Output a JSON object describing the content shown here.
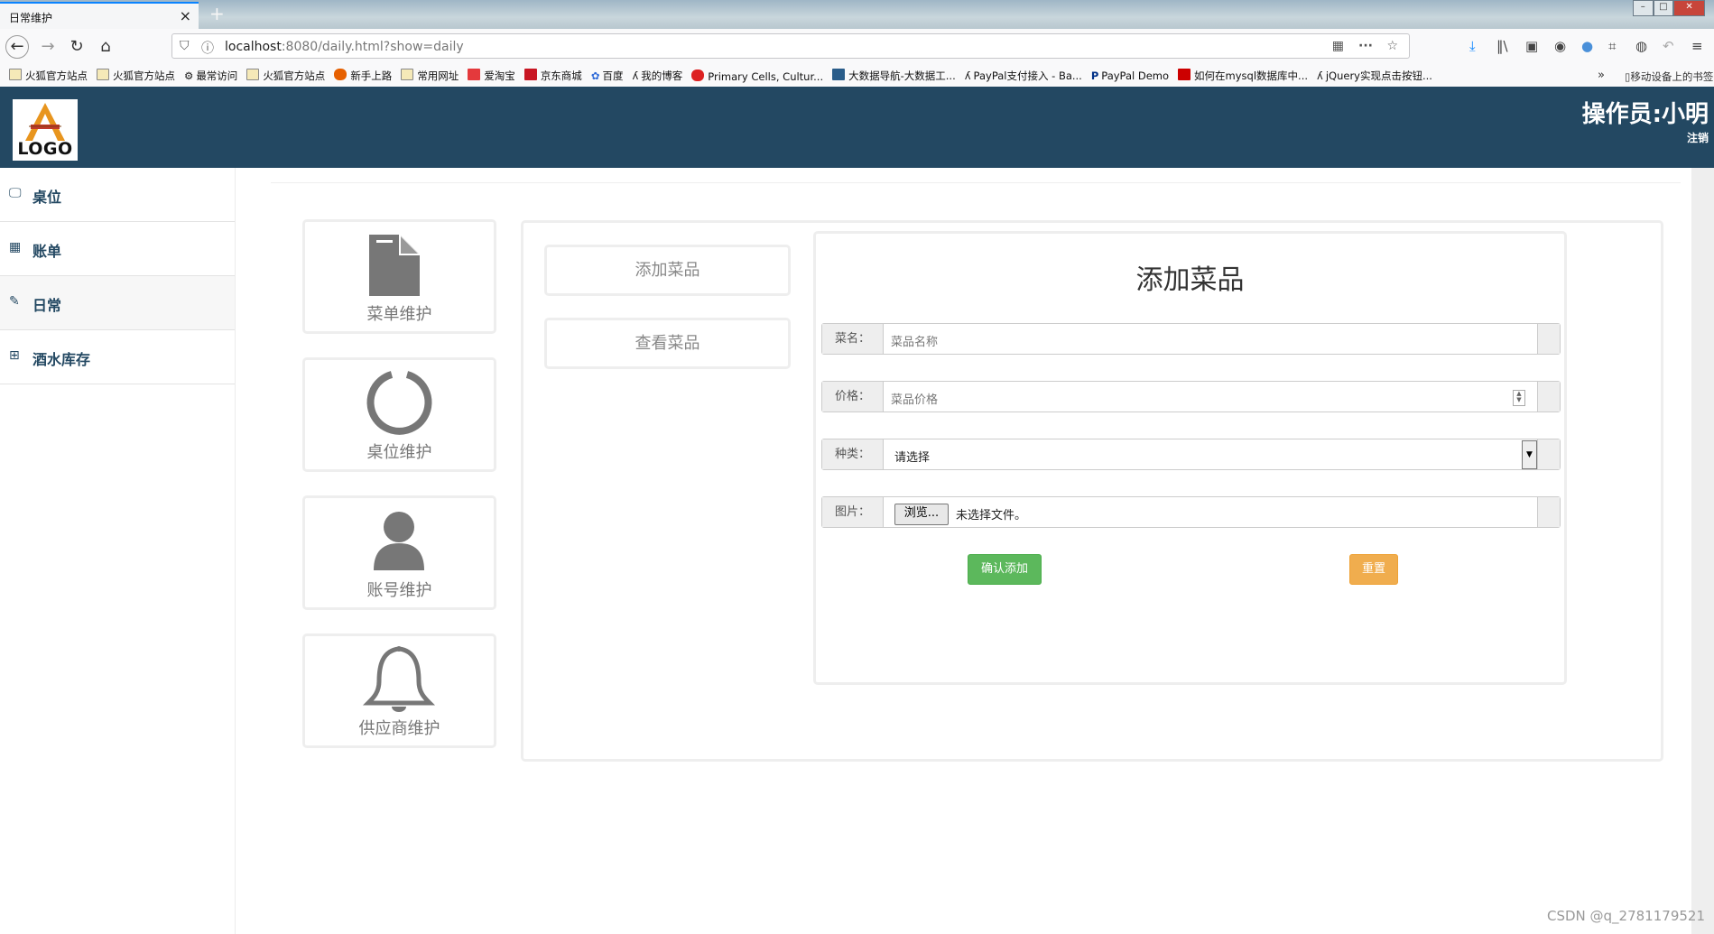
{
  "browser": {
    "tab_title": "日常维护",
    "tab_close": "×",
    "new_tab": "+",
    "url_host": "localhost",
    "url_rest": ":8080/daily.html?show=daily",
    "bookmarks": [
      "火狐官方站点",
      "火狐官方站点",
      "最常访问",
      "火狐官方站点",
      "新手上路",
      "常用网址",
      "爱淘宝",
      "京东商城",
      "百度",
      "我的博客",
      "Primary Cells, Cultur...",
      "大数据导航-大数据工...",
      "PayPal支付接入 - Ba...",
      "PayPal Demo",
      "如何在mysql数据库中...",
      "jQuery实现点击按钮..."
    ],
    "bookmarks_more": "»",
    "bookmarks_mobile": "移动设备上的书签"
  },
  "header": {
    "logo_text": "LOGO",
    "operator": "操作员:小明",
    "logout": "注销"
  },
  "sidebar": {
    "items": [
      {
        "label": "桌位",
        "icon": "monitor-icon"
      },
      {
        "label": "账单",
        "icon": "table-icon"
      },
      {
        "label": "日常",
        "icon": "edit-icon"
      },
      {
        "label": "酒水库存",
        "icon": "grid-icon"
      }
    ],
    "active": "日常"
  },
  "tiles": [
    {
      "label": "菜单维护",
      "icon": "file-icon"
    },
    {
      "label": "桌位维护",
      "icon": "power-ring-icon"
    },
    {
      "label": "账号维护",
      "icon": "user-icon"
    },
    {
      "label": "供应商维护",
      "icon": "bell-icon"
    }
  ],
  "subnav": {
    "add": "添加菜品",
    "view": "查看菜品"
  },
  "form": {
    "title": "添加菜品",
    "name_label": "菜名：",
    "name_placeholder": "菜品名称",
    "price_label": "价格：",
    "price_placeholder": "菜品价格",
    "type_label": "种类：",
    "type_selected": "请选择",
    "image_label": "图片：",
    "browse_label": "浏览...",
    "no_file": "未选择文件。",
    "submit_label": "确认添加",
    "reset_label": "重置"
  },
  "watermark": "CSDN @q_2781179521",
  "colors": {
    "header_bg": "#234862",
    "success": "#5cb85c",
    "warning": "#f0ad4e"
  }
}
